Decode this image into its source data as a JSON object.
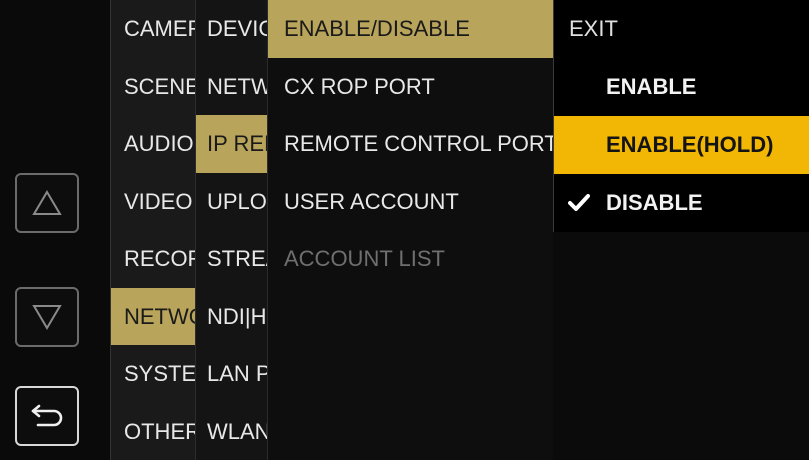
{
  "rail": {
    "up_icon": "triangle-up-icon",
    "down_icon": "triangle-down-icon",
    "back_icon": "return-arrow-icon"
  },
  "menu_level1": {
    "items": [
      {
        "label": "CAMERA"
      },
      {
        "label": "SCENE"
      },
      {
        "label": "AUDIO"
      },
      {
        "label": "VIDEO OUT"
      },
      {
        "label": "RECORDING"
      },
      {
        "label": "NETWORK"
      },
      {
        "label": "SYSTEM"
      },
      {
        "label": "OTHERS"
      }
    ],
    "selected_index": 5
  },
  "menu_level2": {
    "items": [
      {
        "label": "DEVICE"
      },
      {
        "label": "NETWORK"
      },
      {
        "label": "IP REMOTE"
      },
      {
        "label": "UPLOAD"
      },
      {
        "label": "STREAMING"
      },
      {
        "label": "NDI|HX"
      },
      {
        "label": "LAN PROPERTY"
      },
      {
        "label": "WLAN"
      }
    ],
    "selected_index": 2
  },
  "menu_level3": {
    "items": [
      {
        "label": "ENABLE/DISABLE"
      },
      {
        "label": "CX ROP PORT"
      },
      {
        "label": "REMOTE CONTROL PORT"
      },
      {
        "label": "USER ACCOUNT"
      },
      {
        "label": "ACCOUNT LIST"
      }
    ],
    "selected_index": 0,
    "disabled_index": 4
  },
  "options": {
    "exit_label": "EXIT",
    "items": [
      {
        "label": "ENABLE"
      },
      {
        "label": "ENABLE(HOLD)"
      },
      {
        "label": "DISABLE"
      }
    ],
    "highlight_index": 1,
    "checked_index": 2,
    "check_glyph": "✔",
    "check_icon": "checkmark-icon"
  },
  "colors": {
    "selected_path": "#b8a45a",
    "cursor_highlight": "#f2b705"
  }
}
